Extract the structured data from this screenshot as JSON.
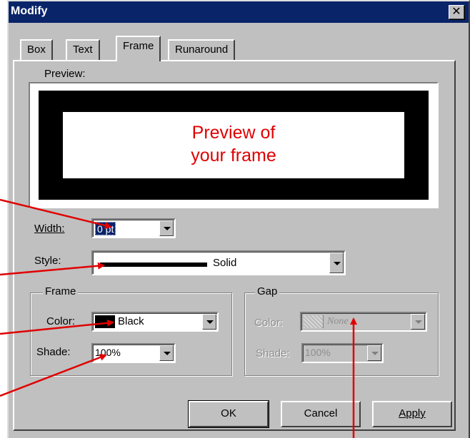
{
  "window": {
    "title": "Modify",
    "close_symbol": "✕"
  },
  "tabs": [
    {
      "label": "Box",
      "active": false
    },
    {
      "label": "Text",
      "active": false
    },
    {
      "label": "Frame",
      "active": true
    },
    {
      "label": "Runaround",
      "active": false
    }
  ],
  "preview": {
    "label": "Preview:",
    "text_line1": "Preview of",
    "text_line2": "your frame",
    "text_color": "#e00000"
  },
  "width_field": {
    "label": "Width:",
    "value": "0 pt"
  },
  "style_field": {
    "label": "Style:",
    "value": "Solid"
  },
  "frame_group": {
    "title": "Frame",
    "color_label": "Color:",
    "color_value": "Black",
    "color_swatch": "#000000",
    "shade_label": "Shade:",
    "shade_value": "100%"
  },
  "gap_group": {
    "title": "Gap",
    "color_label": "Color:",
    "color_value": "None",
    "shade_label": "Shade:",
    "shade_value": "100%"
  },
  "buttons": {
    "ok": "OK",
    "cancel": "Cancel",
    "apply": "Apply"
  },
  "annotation_color": "#e00000"
}
